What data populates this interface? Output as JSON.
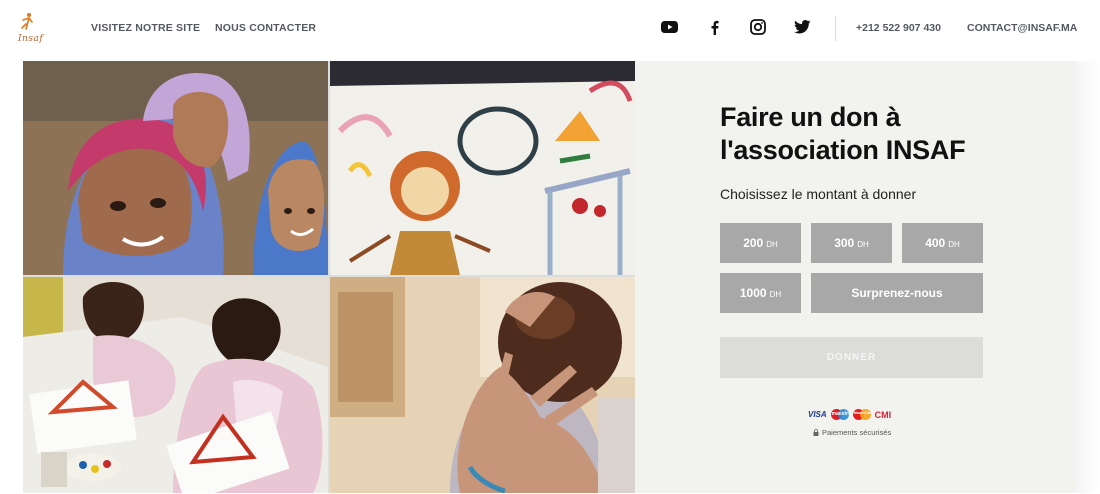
{
  "header": {
    "logo_text": "Insaf",
    "nav": {
      "visit": "VISITEZ NOTRE SITE",
      "contact": "NOUS CONTACTER"
    },
    "social_icons": [
      "youtube-icon",
      "facebook-icon",
      "instagram-icon",
      "twitter-icon"
    ],
    "phone": "+212 522 907 430",
    "email": "CONTACT@INSAF.MA"
  },
  "gallery": {
    "images": [
      "children-smiling-photo",
      "child-drawing-photo",
      "children-painting-photo",
      "mother-baby-photo"
    ]
  },
  "donation": {
    "title": "Faire un don à l'association INSAF",
    "subtitle": "Choisissez le montant à donner",
    "amounts": [
      {
        "value": "200",
        "unit": "DH"
      },
      {
        "value": "300",
        "unit": "DH"
      },
      {
        "value": "400",
        "unit": "DH"
      },
      {
        "value": "1000",
        "unit": "DH"
      }
    ],
    "surprise_label": "Surprenez-nous",
    "donate_label": "DONNER",
    "cards": {
      "visa": "VISA",
      "maestro": "maestro",
      "mastercard": "MasterCard",
      "cmi": "CMI"
    },
    "secure_label": "Paiements sécurisés"
  },
  "colors": {
    "panel_bg": "#f2f2ee",
    "amount_btn": "#a8a8a8",
    "donate_disabled": "#dcdcdb",
    "nav_text": "#55595f"
  }
}
